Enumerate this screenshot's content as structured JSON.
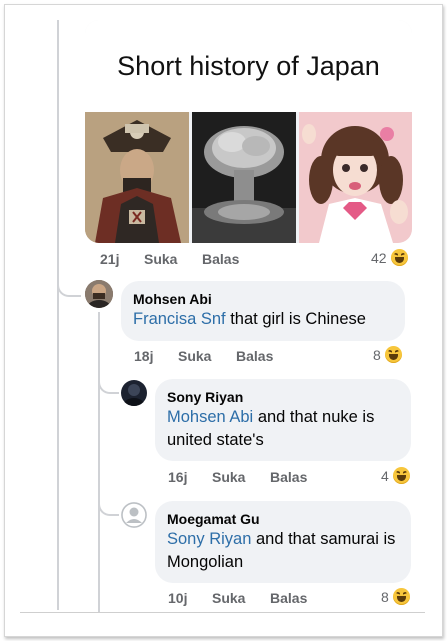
{
  "post": {
    "meme_title": "Short history of Japan",
    "time": "21j",
    "like_label": "Suka",
    "reply_label": "Balas",
    "reaction_count": "42"
  },
  "comments": [
    {
      "author": "Mohsen Abi",
      "mention": "Francisa Snf",
      "text": " that girl is Chinese",
      "time": "18j",
      "like_label": "Suka",
      "reply_label": "Balas",
      "reaction_count": "8"
    },
    {
      "author": "Sony Riyan",
      "mention": "Mohsen Abi",
      "text": " and that nuke is united state's",
      "time": "16j",
      "like_label": "Suka",
      "reply_label": "Balas",
      "reaction_count": "4"
    },
    {
      "author": "Moegamat Gu",
      "mention": "Sony Riyan",
      "text": " and that samurai is Mongolian",
      "time": "10j",
      "like_label": "Suka",
      "reply_label": "Balas",
      "reaction_count": "8"
    }
  ],
  "icons": {
    "reaction": "haha-reaction-icon",
    "default_avatar": "default-avatar-icon"
  },
  "colors": {
    "bubble": "#f0f2f5",
    "mention": "#2d6ea8",
    "meta": "#65676b",
    "reaction": "#f7c63c"
  }
}
